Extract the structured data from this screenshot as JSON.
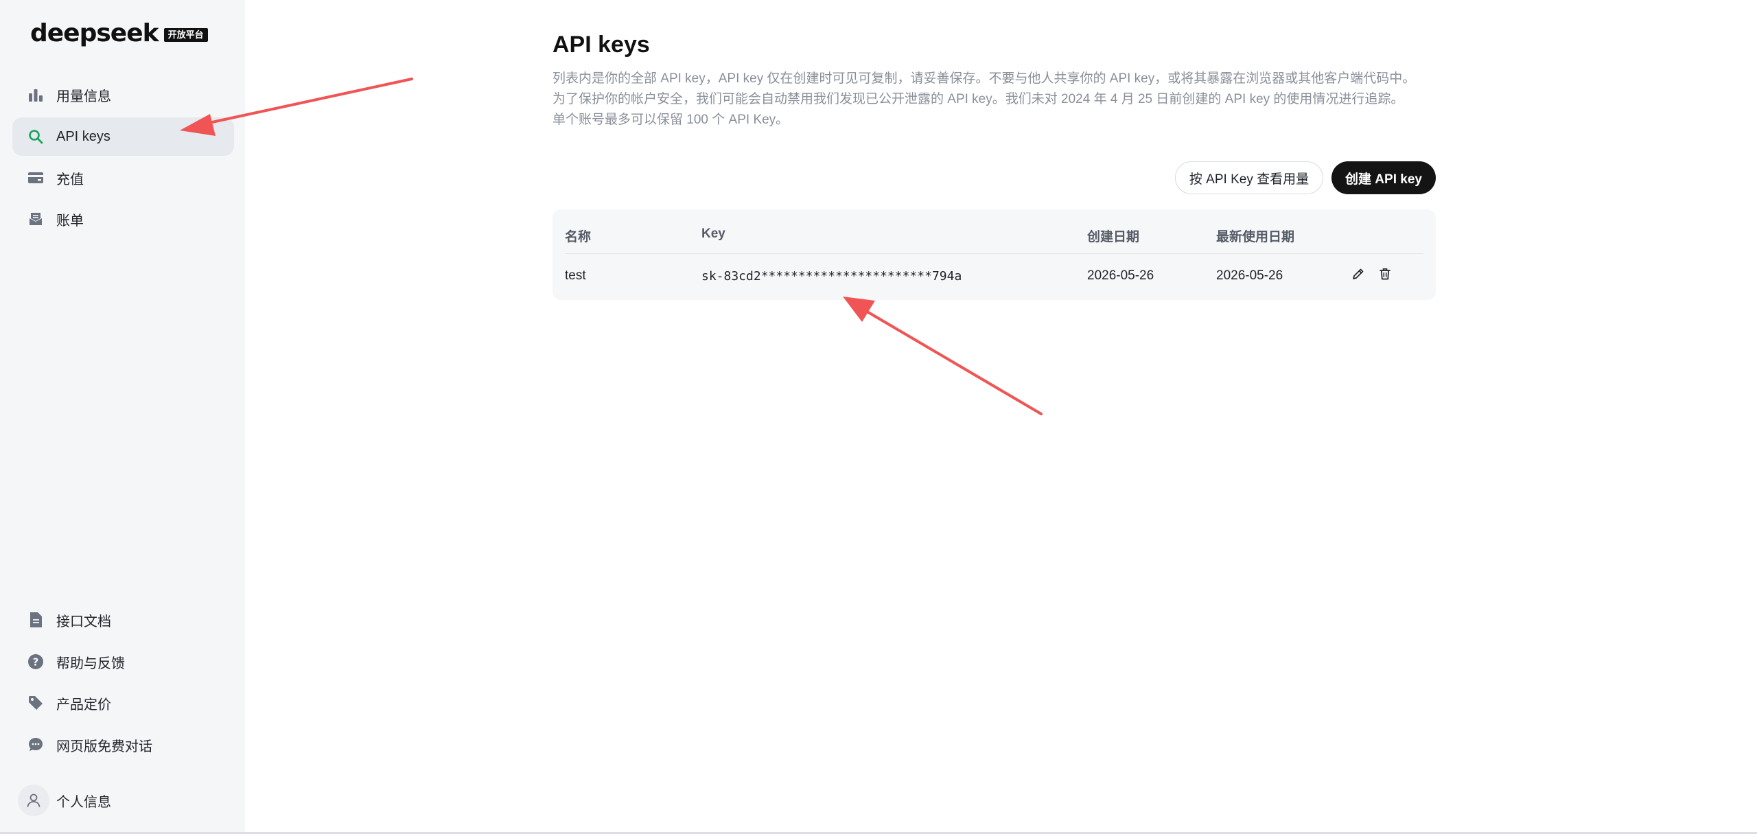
{
  "brand": {
    "logo_text": "deepseek",
    "badge": "开放平台"
  },
  "sidebar": {
    "items": [
      {
        "label": "用量信息",
        "icon": "bar-chart-icon",
        "active": false
      },
      {
        "label": "API keys",
        "icon": "search-key-icon",
        "active": true
      },
      {
        "label": "充值",
        "icon": "wallet-icon",
        "active": false
      },
      {
        "label": "账单",
        "icon": "inbox-icon",
        "active": false
      }
    ],
    "footer_items": [
      {
        "label": "接口文档",
        "icon": "document-icon"
      },
      {
        "label": "帮助与反馈",
        "icon": "help-icon"
      },
      {
        "label": "产品定价",
        "icon": "tag-icon"
      },
      {
        "label": "网页版免费对话",
        "icon": "chat-icon"
      }
    ],
    "profile_label": "个人信息"
  },
  "main": {
    "title": "API keys",
    "description_lines": [
      "列表内是你的全部 API key，API key 仅在创建时可见可复制，请妥善保存。不要与他人共享你的 API key，或将其暴露在浏览器或其他客户端代码中。",
      "为了保护你的帐户安全，我们可能会自动禁用我们发现已公开泄露的 API key。我们未对 2024 年 4 月 25 日前创建的 API key 的使用情况进行追踪。",
      "单个账号最多可以保留 100 个 API Key。"
    ],
    "usage_button": "按 API Key 查看用量",
    "create_button": "创建 API key",
    "table": {
      "headers": [
        "名称",
        "Key",
        "创建日期",
        "最新使用日期"
      ],
      "rows": [
        {
          "name": "test",
          "key": "sk-83cd2***********************794a",
          "created": "2026-05-26",
          "last_used": "2026-05-26"
        }
      ]
    }
  },
  "colors": {
    "sidebar_bg": "#f5f6f8",
    "active_bg": "#e6e9ee",
    "accent_green": "#1aa35a",
    "icon_gray": "#6b7280",
    "arrow_red": "#f05454",
    "dark_button": "#141414"
  }
}
